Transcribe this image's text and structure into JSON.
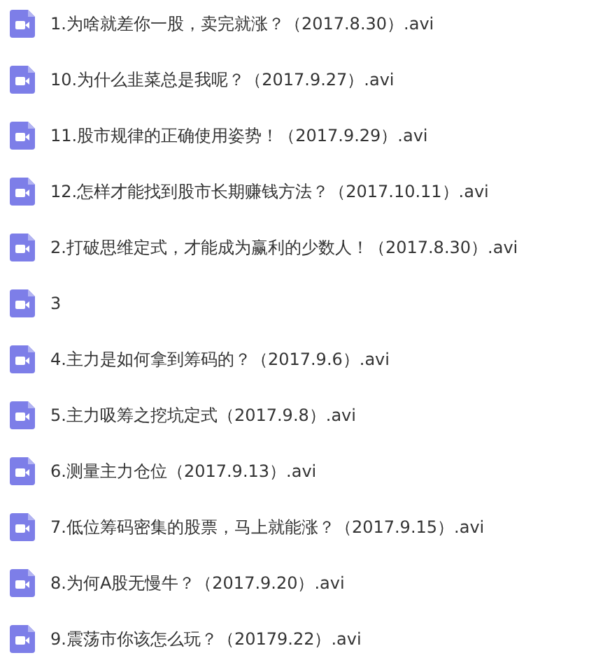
{
  "files": [
    {
      "name": "1.为啥就差你一股，卖完就涨？（2017.8.30）.avi"
    },
    {
      "name": "10.为什么韭菜总是我呢？（2017.9.27）.avi"
    },
    {
      "name": "11.股市规律的正确使用姿势！（2017.9.29）.avi"
    },
    {
      "name": "12.怎样才能找到股市长期赚钱方法？（2017.10.11）.avi"
    },
    {
      "name": "2.打破思维定式，才能成为赢利的少数人！（2017.8.30）.avi"
    },
    {
      "name": "3"
    },
    {
      "name": "4.主力是如何拿到筹码的？（2017.9.6）.avi"
    },
    {
      "name": "5.主力吸筹之挖坑定式（2017.9.8）.avi"
    },
    {
      "name": "6.测量主力仓位（2017.9.13）.avi"
    },
    {
      "name": "7.低位筹码密集的股票，马上就能涨？（2017.9.15）.avi"
    },
    {
      "name": "8.为何A股无慢牛？（2017.9.20）.avi"
    },
    {
      "name": "9.震荡市你该怎么玩？（20179.22）.avi"
    }
  ]
}
